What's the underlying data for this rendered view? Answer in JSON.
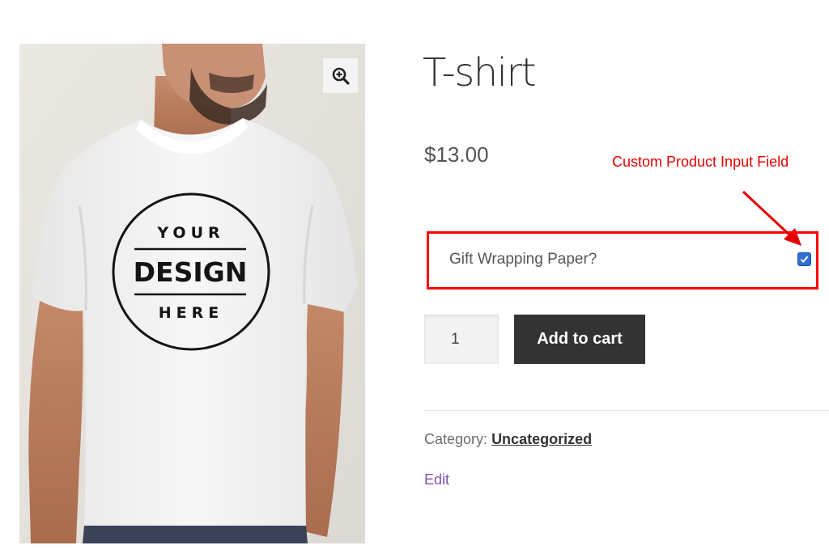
{
  "product": {
    "title": "T-shirt",
    "price": "$13.00",
    "image": {
      "print_line_1": "YOUR",
      "print_line_2": "DESIGN",
      "print_line_3": "HERE",
      "background": "#e7e4df"
    }
  },
  "gallery": {
    "zoom_icon": "zoom-in-magnifier-icon"
  },
  "annotation": {
    "label": "Custom Product Input Field",
    "color": "#ff0000"
  },
  "addon": {
    "label": "Gift Wrapping Paper?",
    "checked": true
  },
  "cart": {
    "quantity": "1",
    "add_label": "Add to cart"
  },
  "meta": {
    "category_label": "Category:",
    "category_value": "Uncategorized",
    "edit_label": "Edit"
  },
  "colors": {
    "button": "#333333",
    "edit_link": "#7f54b3",
    "checkbox": "#2f6fd6"
  }
}
